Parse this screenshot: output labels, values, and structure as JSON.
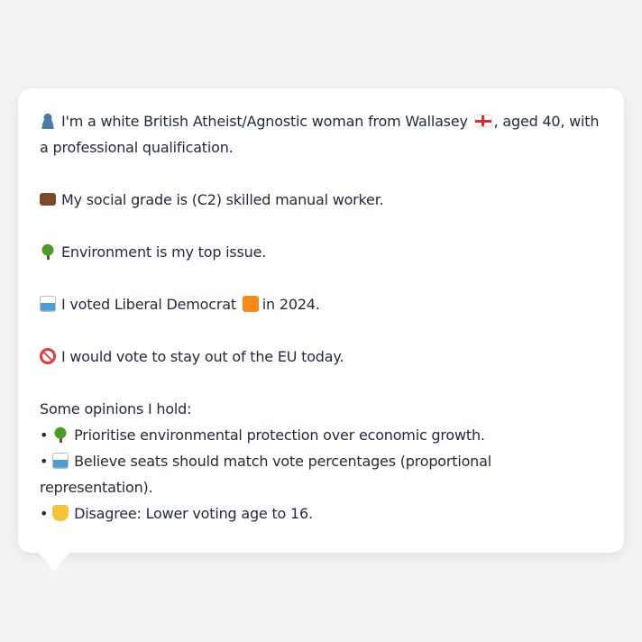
{
  "profile": {
    "line1_pre": "I'm a white British Atheist/Agnostic woman from Wallasey",
    "line1_post": ", aged 40, with a professional qualification.",
    "social_grade": "My social grade is (C2) skilled manual worker.",
    "top_issue": "Environment is my top issue.",
    "vote_pre": "I voted Liberal Democrat",
    "vote_post": "in 2024.",
    "eu": "I would vote to stay out of the EU today.",
    "opinions_heading": "Some opinions I hold:",
    "opinions": [
      {
        "bullet": "•",
        "icon": "deciduous-tree",
        "text": "Prioritise environmental protection over economic growth."
      },
      {
        "bullet": "•",
        "icon": "ballot-box",
        "text": "Believe seats should match vote percentages (proportional representation)."
      },
      {
        "bullet": "•",
        "icon": "thumbs-down",
        "text": "Disagree: Lower voting age to 16."
      }
    ]
  },
  "icons": {
    "person": "bust-in-silhouette",
    "grade": "briefcase",
    "issue": "deciduous-tree",
    "vote": "ballot-box",
    "party": "orange-square",
    "eu": "no-entry",
    "flag": "england-flag"
  },
  "colors": {
    "party": "#f98a1a",
    "background": "#f2f3f5",
    "text": "#1f2a3a"
  }
}
